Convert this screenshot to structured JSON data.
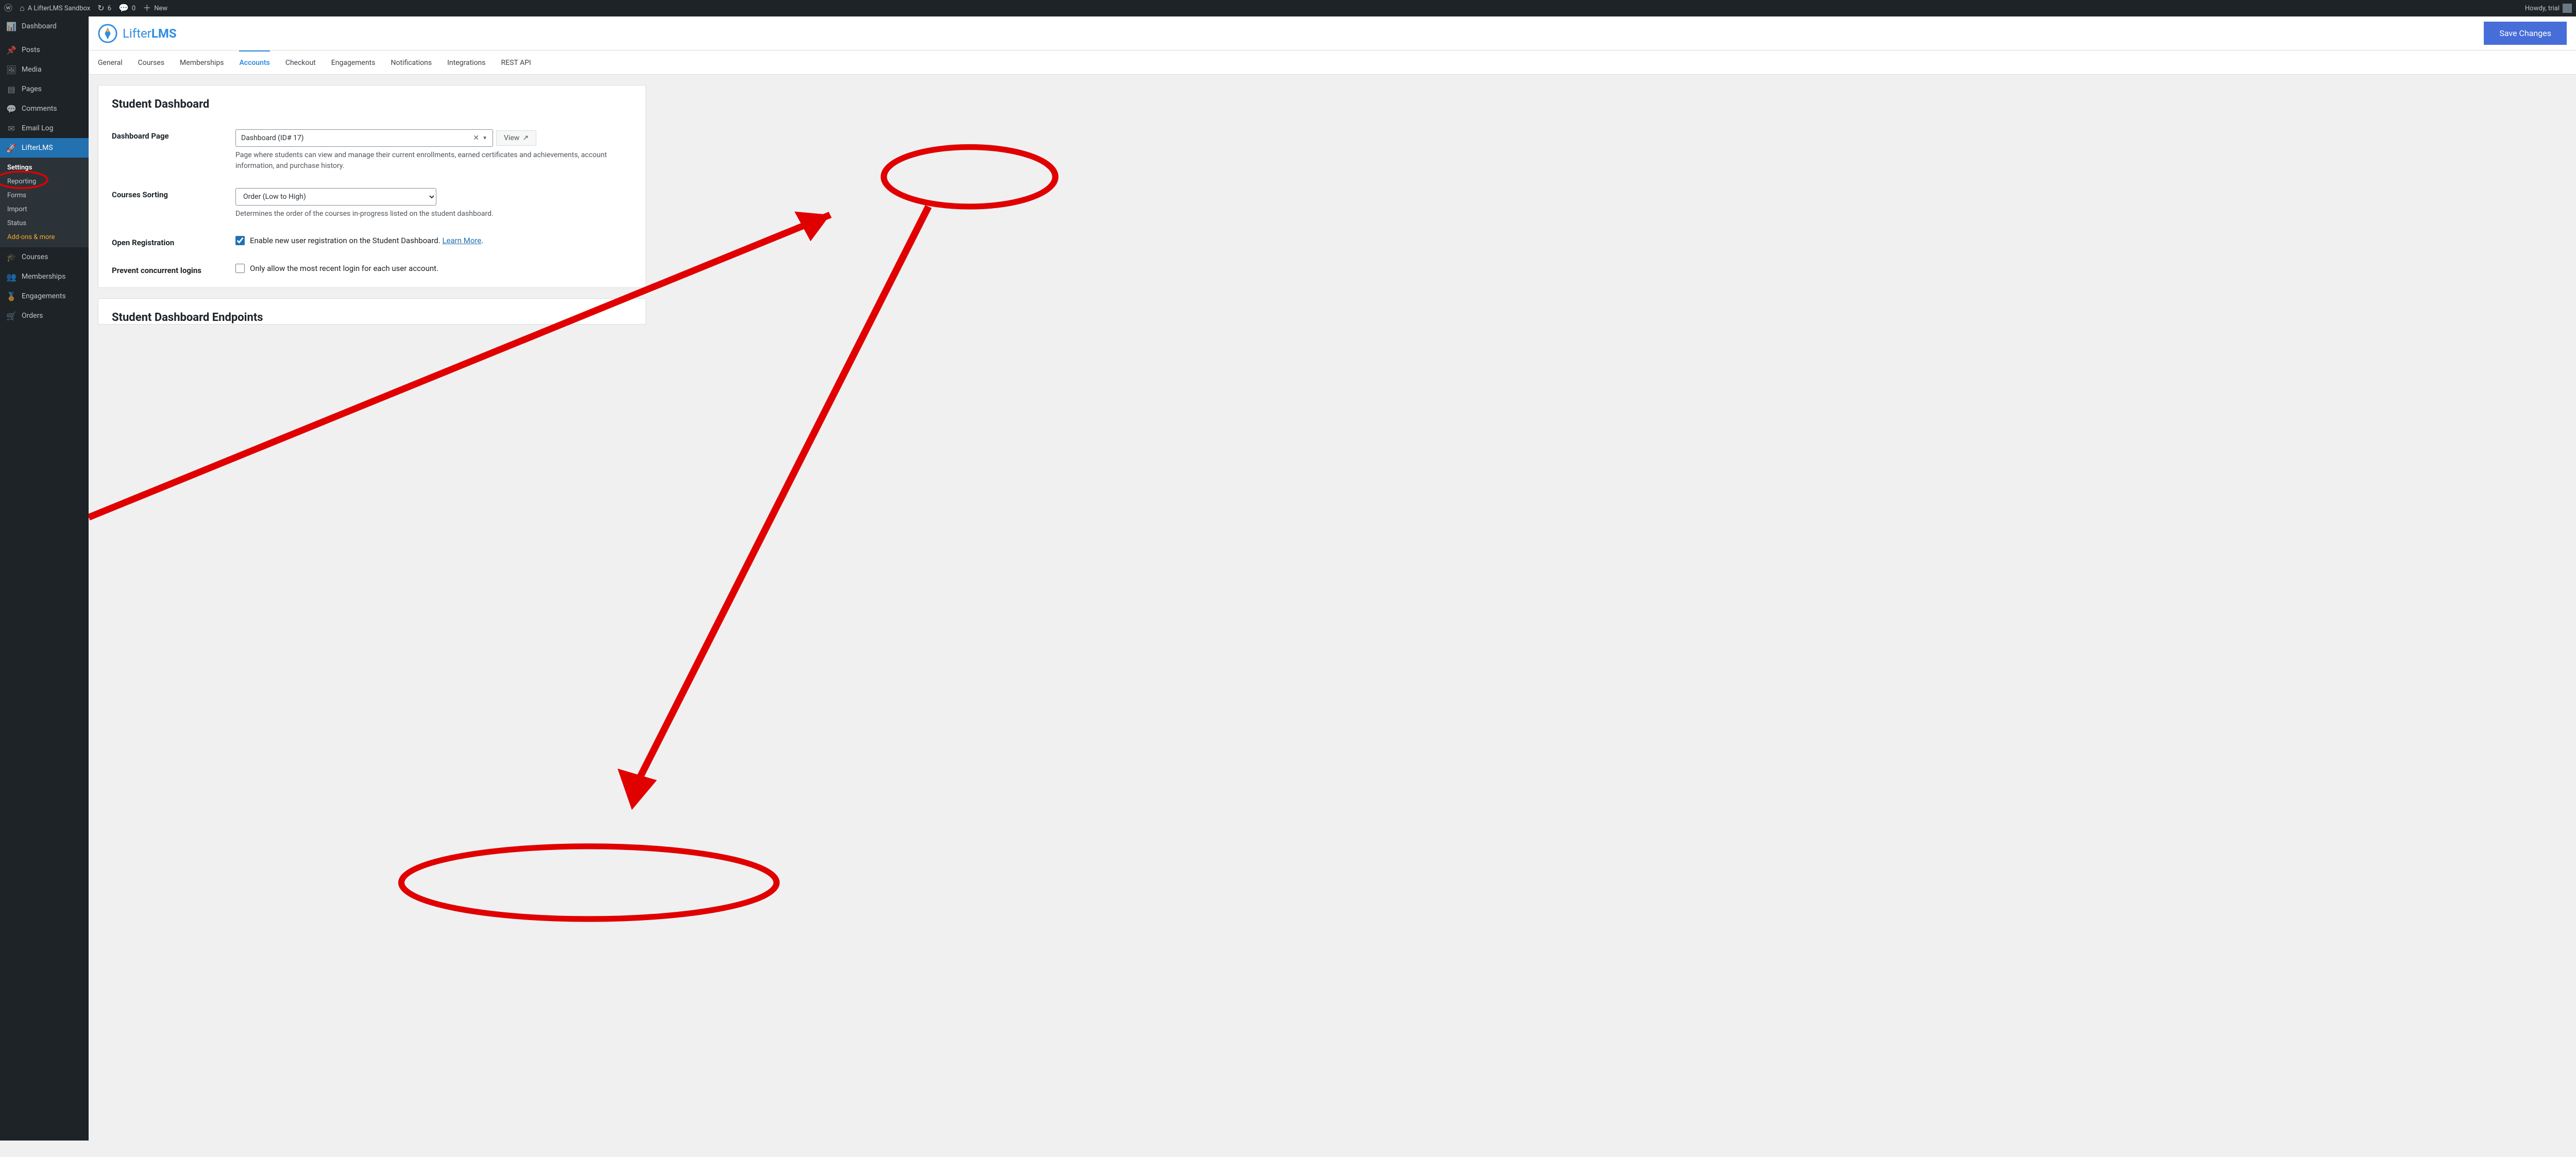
{
  "adminbar": {
    "site_name": "A LifterLMS Sandbox",
    "update_count": "6",
    "comment_count": "0",
    "new_label": "New",
    "howdy": "Howdy, trial"
  },
  "sidebar": {
    "items": [
      {
        "label": "Dashboard",
        "glyph": "🏠"
      },
      {
        "label": "Posts",
        "glyph": "📌"
      },
      {
        "label": "Media",
        "glyph": "🖼"
      },
      {
        "label": "Pages",
        "glyph": "📄"
      },
      {
        "label": "Comments",
        "glyph": "💬"
      },
      {
        "label": "Email Log",
        "glyph": "✉"
      },
      {
        "label": "LifterLMS",
        "glyph": "🚀"
      },
      {
        "label": "Courses",
        "glyph": "🎓"
      },
      {
        "label": "Memberships",
        "glyph": "👥"
      },
      {
        "label": "Engagements",
        "glyph": "🏅"
      },
      {
        "label": "Orders",
        "glyph": "🛒"
      }
    ],
    "sub": {
      "settings": "Settings",
      "reporting": "Reporting",
      "forms": "Forms",
      "import": "Import",
      "status": "Status",
      "addons": "Add-ons & more"
    }
  },
  "header": {
    "brand_a": "Lifter",
    "brand_b": "LMS",
    "save_label": "Save Changes"
  },
  "tabs": [
    "General",
    "Courses",
    "Memberships",
    "Accounts",
    "Checkout",
    "Engagements",
    "Notifications",
    "Integrations",
    "REST API"
  ],
  "active_tab_index": 3,
  "sections": {
    "student_dashboard": {
      "title": "Student Dashboard",
      "rows": {
        "dashboard_page": {
          "label": "Dashboard Page",
          "value": "Dashboard (ID# 17)",
          "view_label": "View",
          "help": "Page where students can view and manage their current enrollments, earned certificates and achievements, account information, and purchase history."
        },
        "courses_sorting": {
          "label": "Courses Sorting",
          "value": "Order (Low to High)",
          "help": "Determines the order of the courses in-progress listed on the student dashboard."
        },
        "open_registration": {
          "label": "Open Registration",
          "checkbox_label": "Enable new user registration on the Student Dashboard.",
          "learn_more": "Learn More",
          "checked": true
        },
        "prevent_concurrent": {
          "label": "Prevent concurrent logins",
          "checkbox_label": "Only allow the most recent login for each user account.",
          "checked": false
        }
      }
    },
    "endpoints_title": "Student Dashboard Endpoints"
  },
  "annotations": {
    "ellipses": [
      {
        "name": "tab-accounts-highlight"
      },
      {
        "name": "sidebar-settings-highlight"
      },
      {
        "name": "prevent-concurrent-highlight"
      }
    ],
    "arrows": [
      {
        "name": "settings-to-accounts-arrow"
      },
      {
        "name": "accounts-to-prevent-arrow"
      }
    ]
  }
}
